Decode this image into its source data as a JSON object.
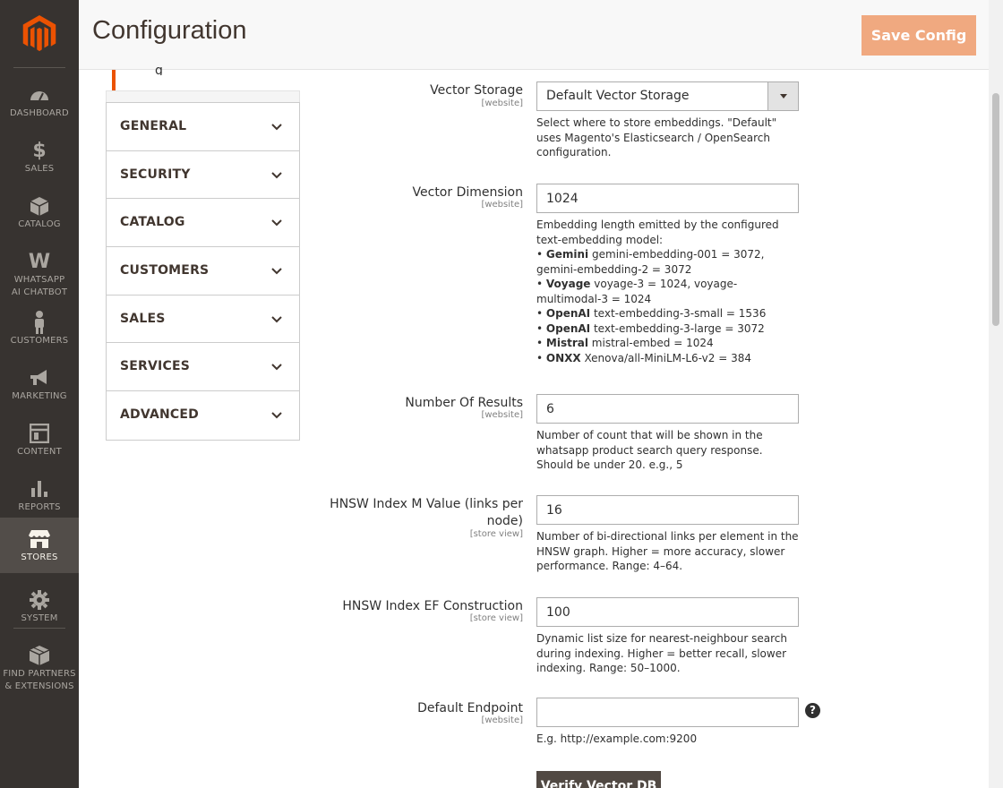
{
  "header": {
    "title": "Configuration",
    "save_label": "Save Config"
  },
  "menu": {
    "items": [
      {
        "label": "DASHBOARD",
        "icon": "dashboard-icon"
      },
      {
        "label": "SALES",
        "icon": "dollar-icon"
      },
      {
        "label": "CATALOG",
        "icon": "box-icon"
      },
      {
        "label": "WHATSAPP AI CHATBOT",
        "icon": "whatsapp-w-icon"
      },
      {
        "label": "CUSTOMERS",
        "icon": "person-icon"
      },
      {
        "label": "MARKETING",
        "icon": "megaphone-icon"
      },
      {
        "label": "CONTENT",
        "icon": "content-icon"
      },
      {
        "label": "REPORTS",
        "icon": "bar-chart-icon"
      },
      {
        "label": "STORES",
        "icon": "store-icon",
        "active": true
      },
      {
        "label": "SYSTEM",
        "icon": "gear-icon"
      },
      {
        "label": "FIND PARTNERS & EXTENSIONS",
        "icon": "blocks-icon"
      }
    ]
  },
  "tabs": [
    {
      "label": "GENERAL"
    },
    {
      "label": "SECURITY"
    },
    {
      "label": "CATALOG"
    },
    {
      "label": "CUSTOMERS"
    },
    {
      "label": "SALES"
    },
    {
      "label": "SERVICES"
    },
    {
      "label": "ADVANCED"
    }
  ],
  "tabs_top_partial": "g",
  "form": {
    "vector_storage": {
      "label": "Vector Storage",
      "scope": "[website]",
      "value": "Default Vector Storage",
      "note": "Select where to store embeddings. \"Default\" uses Magento's Elasticsearch / OpenSearch configuration."
    },
    "vector_dimension": {
      "label": "Vector Dimension",
      "scope": "[website]",
      "value": "1024",
      "note_intro": "Embedding length emitted by the configured text-embedding model:",
      "models": [
        {
          "name": "Gemini",
          "desc": "gemini-embedding-001 = 3072, gemini-embedding-2 = 3072"
        },
        {
          "name": "Voyage",
          "desc": "voyage-3 = 1024, voyage-multimodal-3 = 1024"
        },
        {
          "name": "OpenAI",
          "desc": "text-embedding-3-small = 1536"
        },
        {
          "name": "OpenAI",
          "desc": "text-embedding-3-large = 3072"
        },
        {
          "name": "Mistral",
          "desc": "mistral-embed = 1024"
        },
        {
          "name": "ONXX",
          "desc": "Xenova/all-MiniLM-L6-v2 = 384"
        }
      ]
    },
    "number_of_results": {
      "label": "Number Of Results",
      "scope": "[website]",
      "value": "6",
      "note": "Number of count that will be shown in the whatsapp product search query response. Should be under 20. e.g., 5"
    },
    "hnsw_m": {
      "label_line1": "HNSW Index M Value (links per",
      "label_line2": "node)",
      "scope": "[store view]",
      "value": "16",
      "note": "Number of bi-directional links per element in the HNSW graph. Higher = more accuracy, slower performance. Range: 4–64."
    },
    "hnsw_ef": {
      "label": "HNSW Index EF Construction",
      "scope": "[store view]",
      "value": "100",
      "note": "Dynamic list size for nearest-neighbour search during indexing. Higher = better recall, slower indexing. Range: 50–1000."
    },
    "default_endpoint": {
      "label": "Default Endpoint",
      "scope": "[website]",
      "value": "",
      "note": "E.g. http://example.com:9200",
      "help": "?"
    },
    "verify_label": "Verify Vector DB"
  },
  "colors": {
    "menu_bg": "#373330",
    "accent": "#eb5202",
    "save_btn": "#f0a980",
    "verify_btn": "#514943"
  }
}
